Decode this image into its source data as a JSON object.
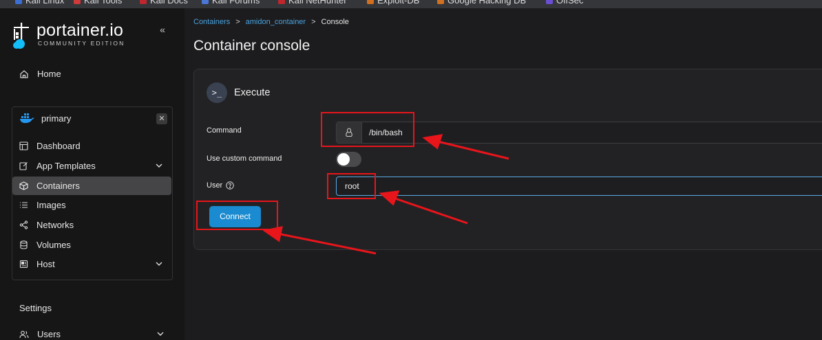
{
  "bookmarks": [
    {
      "label": "Kali Linux",
      "color": "#3b6fd6"
    },
    {
      "label": "Kali Tools",
      "color": "#d03a3a"
    },
    {
      "label": "Kali Docs",
      "color": "#c0262d"
    },
    {
      "label": "Kali Forums",
      "color": "#4a76d6"
    },
    {
      "label": "Kali NetHunter",
      "color": "#c0262d"
    },
    {
      "label": "Exploit-DB",
      "color": "#d07020"
    },
    {
      "label": "Google Hacking DB",
      "color": "#d07020"
    },
    {
      "label": "OffSec",
      "color": "#6a4fd6"
    }
  ],
  "sidebar": {
    "logo_text": "portainer.io",
    "logo_sub": "COMMUNITY EDITION",
    "home": "Home",
    "environment": {
      "name": "primary",
      "items": [
        {
          "label": "Dashboard"
        },
        {
          "label": "App Templates"
        },
        {
          "label": "Containers"
        },
        {
          "label": "Images"
        },
        {
          "label": "Networks"
        },
        {
          "label": "Volumes"
        },
        {
          "label": "Host"
        }
      ]
    },
    "settings": "Settings",
    "users": "Users"
  },
  "breadcrumb": {
    "containers": "Containers",
    "container": "amidon_container",
    "current": "Console"
  },
  "page_title": "Container console",
  "panel": {
    "title": "Execute",
    "command_label": "Command",
    "command_value": "/bin/bash",
    "custom_label": "Use custom command",
    "user_label": "User",
    "user_value": "root",
    "connect_label": "Connect"
  },
  "colors": {
    "accent": "#1a8bd0",
    "link": "#4aa3df",
    "annotation": "#e8151b"
  }
}
